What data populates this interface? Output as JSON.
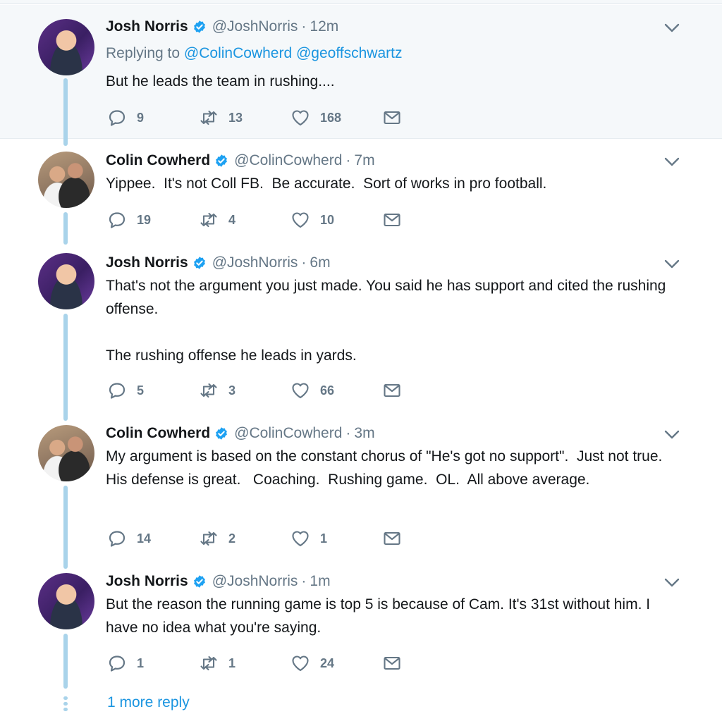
{
  "tweets": [
    {
      "name": "Josh Norris",
      "handle": "@JoshNorris",
      "time": "12m",
      "reply_prefix": "Replying to ",
      "reply_mentions": [
        "@ColinCowherd",
        "@geoffschwartz"
      ],
      "text": "But he leads the team in rushing....",
      "replies": "9",
      "retweets": "13",
      "likes": "168"
    },
    {
      "name": "Colin Cowherd",
      "handle": "@ColinCowherd",
      "time": "7m",
      "text": "Yippee.  It's not Coll FB.  Be accurate.  Sort of works in pro football.",
      "replies": "19",
      "retweets": "4",
      "likes": "10"
    },
    {
      "name": "Josh Norris",
      "handle": "@JoshNorris",
      "time": "6m",
      "text": "That's not the argument you just made. You said he has support and cited the rushing offense.\n\nThe rushing offense he leads in yards.",
      "replies": "5",
      "retweets": "3",
      "likes": "66"
    },
    {
      "name": "Colin Cowherd",
      "handle": "@ColinCowherd",
      "time": "3m",
      "text": "My argument is based on the constant chorus of \"He's got no support\".  Just not true.  His defense is great.   Coaching.  Rushing game.  OL.  All above average.",
      "replies": "14",
      "retweets": "2",
      "likes": "1"
    },
    {
      "name": "Josh Norris",
      "handle": "@JoshNorris",
      "time": "1m",
      "text": "But the reason the running game is top 5 is because of Cam. It's 31st without him. I have no idea what you're saying.",
      "replies": "1",
      "retweets": "1",
      "likes": "24"
    }
  ],
  "separator": "·",
  "more_replies": "1 more reply",
  "icons": {
    "verified": "verified-badge-icon",
    "caret": "chevron-down-icon",
    "reply": "reply-icon",
    "retweet": "retweet-icon",
    "like": "heart-icon",
    "dm": "envelope-icon"
  },
  "colors": {
    "link": "#1b95e0",
    "muted": "#657786",
    "thread_line": "#a9d3ea",
    "highlight_bg": "#f5f8fa"
  }
}
